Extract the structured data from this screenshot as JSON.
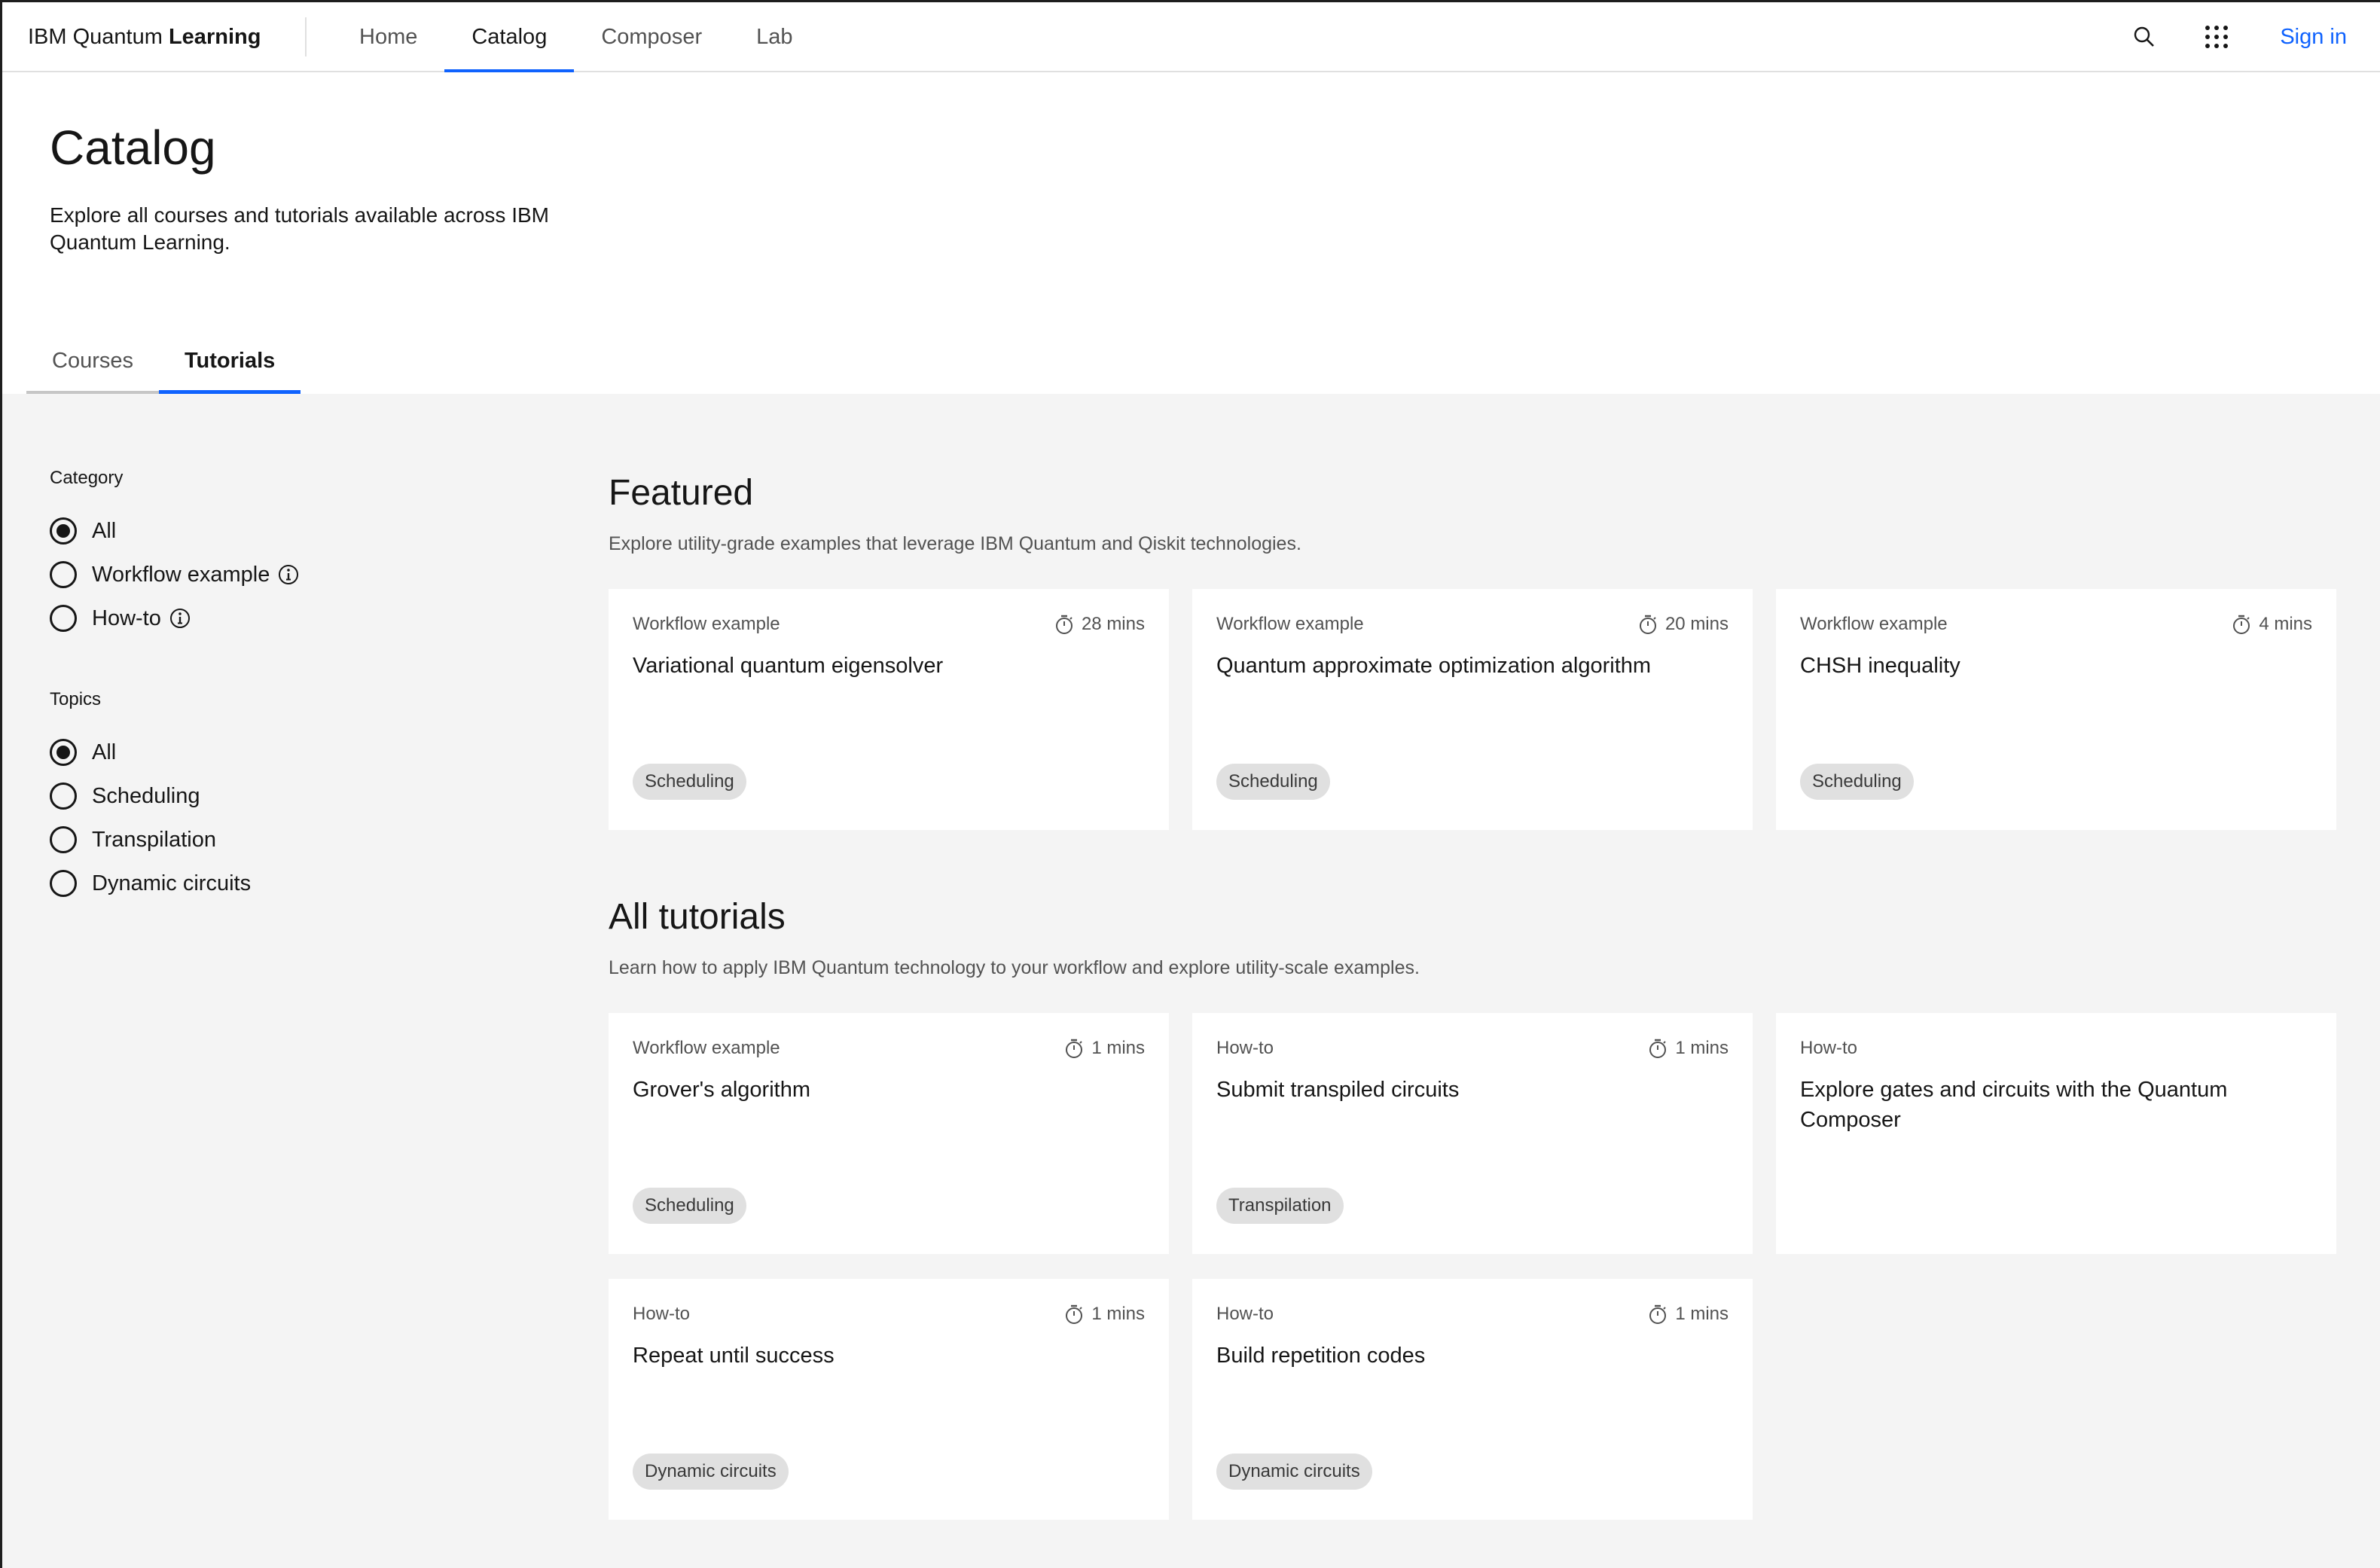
{
  "header": {
    "brand_regular": "IBM Quantum ",
    "brand_bold": "Learning",
    "nav": [
      {
        "label": "Home"
      },
      {
        "label": "Catalog"
      },
      {
        "label": "Composer"
      },
      {
        "label": "Lab"
      }
    ],
    "active_nav": "Catalog",
    "sign_in": "Sign in",
    "icons": [
      "search-icon",
      "app-switcher-icon"
    ]
  },
  "page": {
    "title": "Catalog",
    "description": "Explore all courses and tutorials available across IBM Quantum Learning.",
    "tabs": [
      {
        "label": "Courses"
      },
      {
        "label": "Tutorials"
      }
    ],
    "active_tab": "Tutorials"
  },
  "filters": {
    "category": {
      "legend": "Category",
      "options": [
        {
          "label": "All",
          "checked": true
        },
        {
          "label": "Workflow example",
          "info": true
        },
        {
          "label": "How-to",
          "info": true
        }
      ]
    },
    "topics": {
      "legend": "Topics",
      "options": [
        {
          "label": "All",
          "checked": true
        },
        {
          "label": "Scheduling"
        },
        {
          "label": "Transpilation"
        },
        {
          "label": "Dynamic circuits"
        }
      ]
    }
  },
  "featured": {
    "title": "Featured",
    "subtitle": "Explore utility-grade examples that leverage IBM Quantum and Qiskit technologies.",
    "cards": [
      {
        "type": "Workflow example",
        "duration": "28 mins",
        "title": "Variational quantum eigensolver",
        "tag": "Scheduling"
      },
      {
        "type": "Workflow example",
        "duration": "20 mins",
        "title": "Quantum approximate optimization algorithm",
        "tag": "Scheduling"
      },
      {
        "type": "Workflow example",
        "duration": "4 mins",
        "title": "CHSH inequality",
        "tag": "Scheduling"
      }
    ]
  },
  "all_tutorials": {
    "title": "All tutorials",
    "subtitle": "Learn how to apply IBM Quantum technology to your workflow and explore utility-scale examples.",
    "cards": [
      {
        "type": "Workflow example",
        "duration": "1 mins",
        "title": "Grover's algorithm",
        "tag": "Scheduling"
      },
      {
        "type": "How-to",
        "duration": "1 mins",
        "title": "Submit transpiled circuits",
        "tag": "Transpilation"
      },
      {
        "type": "How-to",
        "duration": "",
        "title": "Explore gates and circuits with the Quantum Composer",
        "tag": ""
      },
      {
        "type": "How-to",
        "duration": "1 mins",
        "title": "Repeat until success",
        "tag": "Dynamic circuits"
      },
      {
        "type": "How-to",
        "duration": "1 mins",
        "title": "Build repetition codes",
        "tag": "Dynamic circuits"
      }
    ]
  },
  "colors": {
    "accent": "#0f62fe",
    "background": "#f4f4f4",
    "tag_bg": "#e0e0e0"
  }
}
